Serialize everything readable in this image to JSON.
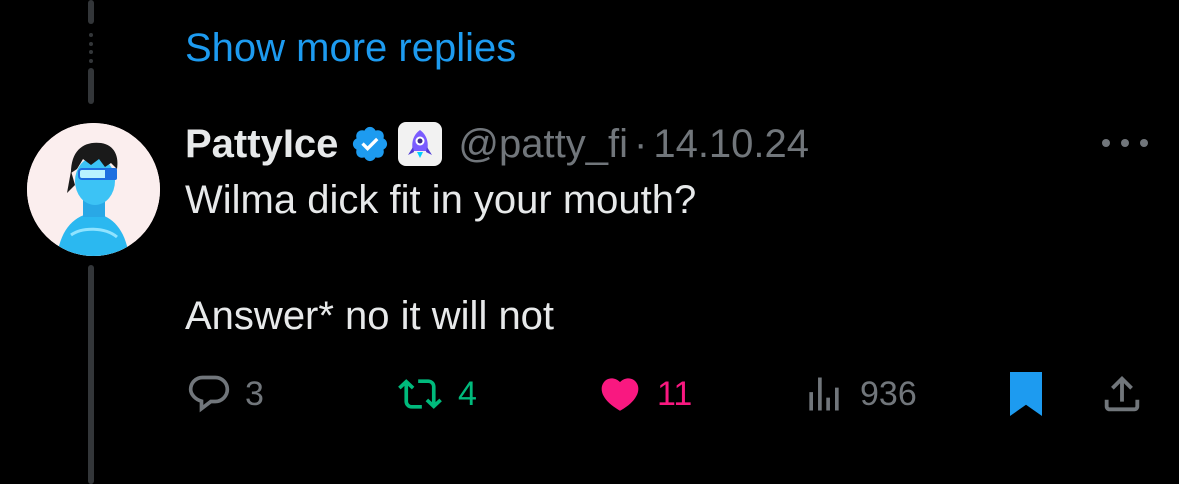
{
  "thread": {
    "show_more": "Show more replies"
  },
  "tweet": {
    "display_name": "PattyIce",
    "handle": "@patty_fi",
    "separator": "·",
    "date": "14.10.24",
    "text_line1": "Wilma dick fit in your mouth?",
    "text_line2": "Answer* no it will not",
    "verified_badge": "verified-badge-icon",
    "affiliate_badge": "rocket-affiliate-icon"
  },
  "actions": {
    "replies": "3",
    "retweets": "4",
    "likes": "11",
    "views": "936",
    "bookmarked": true,
    "liked": true
  },
  "colors": {
    "link": "#1d9bf0",
    "retweet": "#00ba7c",
    "like": "#f91880",
    "bookmark": "#1d9bf0",
    "muted": "#71767b",
    "thread_line": "#333639"
  }
}
